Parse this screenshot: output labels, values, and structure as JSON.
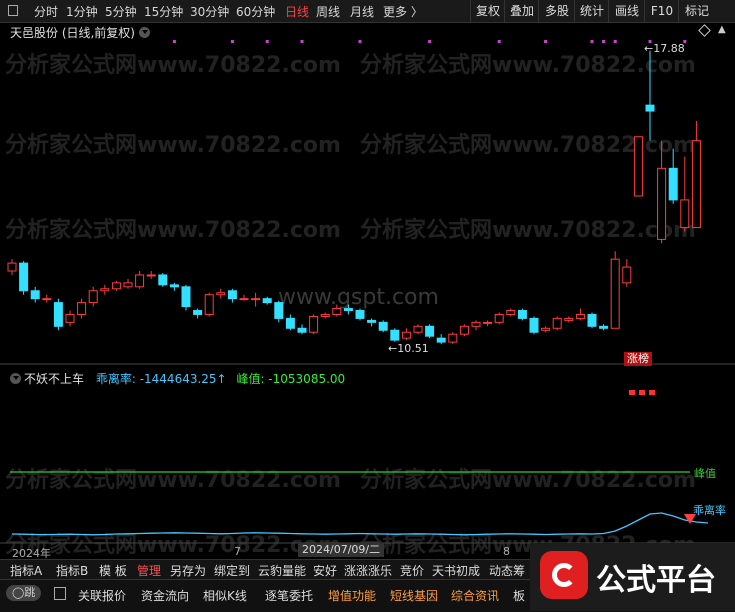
{
  "toolbar": {
    "timeframes": [
      "分时",
      "1分钟",
      "5分钟",
      "15分钟",
      "30分钟",
      "60分钟",
      "日线",
      "周线",
      "月线",
      "更多 〉"
    ],
    "active_timeframe": "日线",
    "buttons": [
      "复权",
      "叠加",
      "多股",
      "统计",
      "画线",
      "F10",
      "标记"
    ]
  },
  "main": {
    "title": "天邑股份 (日线,前复权)",
    "high_label": "17.88",
    "low_label": "10.51",
    "limit_up_tag": "涨榜",
    "watermark": "分析家公式网www.70822.com",
    "watermark2": "www.gspt.com"
  },
  "indicator": {
    "name": "不妖不上车",
    "line1_label": "乖离率: -1444643.25↑",
    "line2_label": "峰值: -1053085.00",
    "right_label1": "峰值",
    "right_label2": "乖离率"
  },
  "axis": {
    "year_label": "2024年",
    "month_7": "7",
    "date_label": "2024/07/09/二",
    "month_8": "8"
  },
  "tabs": [
    "指标A",
    "指标B",
    "模 板",
    "管理",
    "另存为",
    "绑定到",
    "云豹量能",
    "安好",
    "涨涨涨乐",
    "竞价",
    "天书初成",
    "动态筹"
  ],
  "active_tab": "管理",
  "bottom_bar": {
    "toggle_label": "◯跳",
    "items": [
      "关联报价",
      "资金流向",
      "相似K线",
      "逐笔委托",
      "增值功能",
      "短线基因",
      "综合资讯",
      "板"
    ]
  },
  "logo_text": "公式平台",
  "colors": {
    "up": "#ff3c3c",
    "down": "#33e0ff",
    "green_line": "#33cc33",
    "accent": "#ff4040"
  },
  "chart_data": {
    "type": "candlestick",
    "candles": [
      {
        "o": 12.3,
        "c": 12.5,
        "h": 12.6,
        "l": 12.2
      },
      {
        "o": 12.5,
        "c": 11.8,
        "h": 12.55,
        "l": 11.7
      },
      {
        "o": 11.8,
        "c": 11.6,
        "h": 11.9,
        "l": 11.5
      },
      {
        "o": 11.6,
        "c": 11.6,
        "h": 11.7,
        "l": 11.5
      },
      {
        "o": 11.5,
        "c": 10.9,
        "h": 11.6,
        "l": 10.8
      },
      {
        "o": 11.0,
        "c": 11.2,
        "h": 11.3,
        "l": 10.9
      },
      {
        "o": 11.2,
        "c": 11.5,
        "h": 11.6,
        "l": 11.1
      },
      {
        "o": 11.5,
        "c": 11.8,
        "h": 11.9,
        "l": 11.4
      },
      {
        "o": 11.8,
        "c": 11.85,
        "h": 11.95,
        "l": 11.7
      },
      {
        "o": 11.85,
        "c": 12.0,
        "h": 12.05,
        "l": 11.8
      },
      {
        "o": 11.9,
        "c": 12.0,
        "h": 12.1,
        "l": 11.85
      },
      {
        "o": 11.9,
        "c": 12.2,
        "h": 12.3,
        "l": 11.85
      },
      {
        "o": 12.2,
        "c": 12.2,
        "h": 12.3,
        "l": 12.1
      },
      {
        "o": 12.2,
        "c": 11.95,
        "h": 12.25,
        "l": 11.9
      },
      {
        "o": 11.95,
        "c": 11.9,
        "h": 12.0,
        "l": 11.8
      },
      {
        "o": 11.9,
        "c": 11.4,
        "h": 11.95,
        "l": 11.3
      },
      {
        "o": 11.3,
        "c": 11.2,
        "h": 11.35,
        "l": 11.1
      },
      {
        "o": 11.2,
        "c": 11.7,
        "h": 11.75,
        "l": 11.15
      },
      {
        "o": 11.7,
        "c": 11.75,
        "h": 11.85,
        "l": 11.6
      },
      {
        "o": 11.8,
        "c": 11.6,
        "h": 11.85,
        "l": 11.5
      },
      {
        "o": 11.6,
        "c": 11.6,
        "h": 11.7,
        "l": 11.55
      },
      {
        "o": 11.6,
        "c": 11.6,
        "h": 11.75,
        "l": 11.4
      },
      {
        "o": 11.6,
        "c": 11.5,
        "h": 11.65,
        "l": 11.45
      },
      {
        "o": 11.5,
        "c": 11.1,
        "h": 11.55,
        "l": 11.0
      },
      {
        "o": 11.1,
        "c": 10.85,
        "h": 11.2,
        "l": 10.8
      },
      {
        "o": 10.85,
        "c": 10.75,
        "h": 10.95,
        "l": 10.7
      },
      {
        "o": 10.75,
        "c": 11.15,
        "h": 11.2,
        "l": 10.7
      },
      {
        "o": 11.15,
        "c": 11.2,
        "h": 11.25,
        "l": 11.1
      },
      {
        "o": 11.2,
        "c": 11.35,
        "h": 11.45,
        "l": 11.15
      },
      {
        "o": 11.35,
        "c": 11.3,
        "h": 11.45,
        "l": 11.2
      },
      {
        "o": 11.3,
        "c": 11.1,
        "h": 11.35,
        "l": 11.05
      },
      {
        "o": 11.05,
        "c": 11.0,
        "h": 11.1,
        "l": 10.9
      },
      {
        "o": 11.0,
        "c": 10.8,
        "h": 11.05,
        "l": 10.75
      },
      {
        "o": 10.8,
        "c": 10.55,
        "h": 10.85,
        "l": 10.51
      },
      {
        "o": 10.6,
        "c": 10.75,
        "h": 10.85,
        "l": 10.55
      },
      {
        "o": 10.75,
        "c": 10.9,
        "h": 10.95,
        "l": 10.7
      },
      {
        "o": 10.9,
        "c": 10.65,
        "h": 10.95,
        "l": 10.6
      },
      {
        "o": 10.6,
        "c": 10.5,
        "h": 10.7,
        "l": 10.45
      },
      {
        "o": 10.5,
        "c": 10.7,
        "h": 10.75,
        "l": 10.45
      },
      {
        "o": 10.7,
        "c": 10.9,
        "h": 10.95,
        "l": 10.65
      },
      {
        "o": 10.9,
        "c": 11.0,
        "h": 11.05,
        "l": 10.8
      },
      {
        "o": 11.0,
        "c": 11.0,
        "h": 11.05,
        "l": 10.9
      },
      {
        "o": 11.0,
        "c": 11.2,
        "h": 11.25,
        "l": 10.95
      },
      {
        "o": 11.2,
        "c": 11.3,
        "h": 11.35,
        "l": 11.15
      },
      {
        "o": 11.3,
        "c": 11.1,
        "h": 11.35,
        "l": 11.05
      },
      {
        "o": 11.1,
        "c": 10.75,
        "h": 11.15,
        "l": 10.7
      },
      {
        "o": 10.8,
        "c": 10.85,
        "h": 10.9,
        "l": 10.75
      },
      {
        "o": 10.85,
        "c": 11.1,
        "h": 11.15,
        "l": 10.8
      },
      {
        "o": 11.05,
        "c": 11.1,
        "h": 11.15,
        "l": 11.0
      },
      {
        "o": 11.1,
        "c": 11.2,
        "h": 11.35,
        "l": 11.05
      },
      {
        "o": 11.2,
        "c": 10.9,
        "h": 11.25,
        "l": 10.85
      },
      {
        "o": 10.9,
        "c": 10.85,
        "h": 10.95,
        "l": 10.8
      },
      {
        "o": 10.85,
        "c": 12.6,
        "h": 12.8,
        "l": 10.85
      },
      {
        "o": 12.0,
        "c": 12.4,
        "h": 12.6,
        "l": 11.9
      },
      {
        "o": 14.2,
        "c": 15.7,
        "h": 15.7,
        "l": 14.2
      },
      {
        "o": 16.5,
        "c": 16.35,
        "h": 17.88,
        "l": 15.6
      },
      {
        "o": 13.1,
        "c": 14.9,
        "h": 15.6,
        "l": 13.0
      },
      {
        "o": 14.9,
        "c": 14.1,
        "h": 15.4,
        "l": 14.0
      },
      {
        "o": 13.4,
        "c": 14.1,
        "h": 15.2,
        "l": 13.3
      },
      {
        "o": 13.4,
        "c": 15.6,
        "h": 16.1,
        "l": 13.4
      }
    ],
    "indicator_line": [
      0.2,
      0.18,
      0.15,
      0.14,
      0.16,
      0.18,
      0.15,
      0.12,
      0.15,
      0.2,
      0.22,
      0.25,
      0.28,
      0.3,
      0.32,
      0.3,
      0.28,
      0.25,
      0.22,
      0.25,
      0.3,
      0.32,
      0.3,
      0.28,
      0.25,
      0.22,
      0.2,
      0.18,
      0.2,
      0.22,
      0.25,
      0.22,
      0.2,
      0.18,
      0.2,
      0.22,
      0.2,
      0.18,
      0.15,
      0.12,
      0.15,
      0.18,
      0.2,
      0.22,
      0.2,
      0.18,
      0.15,
      0.18,
      0.2,
      0.22,
      0.2,
      0.25,
      0.5,
      1.0,
      1.6,
      2.2,
      2.3,
      2.0,
      1.6,
      1.4,
      1.3
    ]
  }
}
